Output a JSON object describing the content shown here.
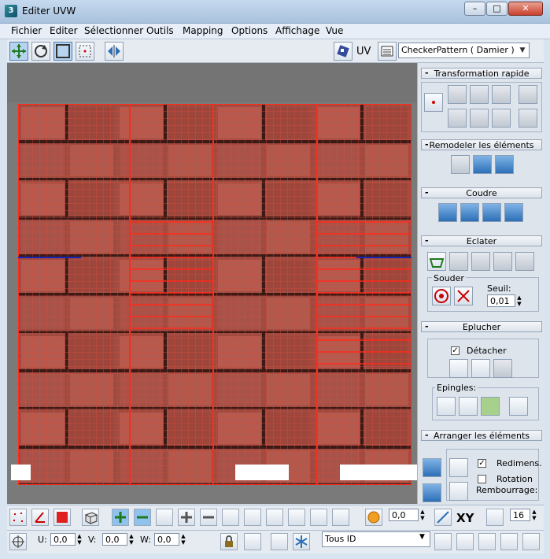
{
  "window": {
    "title": "Editer UVW",
    "min": "–",
    "max": "□",
    "close": "✕"
  },
  "menu": [
    "Fichier",
    "Editer",
    "Sélectionner",
    "Outils",
    "Mapping",
    "Options",
    "Affichage",
    "Vue"
  ],
  "toolbar": {
    "uv_label": "UV",
    "texture_select": "CheckerPattern  ( Damier )",
    "select_arrow": "▼"
  },
  "panel": {
    "transformation": "Transformation rapide",
    "remodeler": "Remodeler les éléments",
    "coudre": "Coudre",
    "eclater": "Eclater",
    "souder": "Souder",
    "seuil_label": "Seuil:",
    "seuil_value": "0,01",
    "eplucher": "Eplucher",
    "detacher": "Détacher",
    "epingles": "Epingles:",
    "arranger": "Arranger les éléments",
    "redimens": "Redimens.",
    "rotation": "Rotation",
    "rembourrage": "Rembourrage:",
    "minus": "-"
  },
  "bottom1": {
    "value": "0,0",
    "xy": "XY",
    "zoom": "16"
  },
  "bottom2": {
    "u_label": "U:",
    "u_value": "0,0",
    "v_label": "V:",
    "v_value": "0,0",
    "w_label": "W:",
    "w_value": "0,0",
    "id_select": "Tous ID"
  },
  "colors": {
    "uv_line": "#ff2a1a",
    "accent": "#2c6fb7",
    "texture": "#8a3d36"
  }
}
